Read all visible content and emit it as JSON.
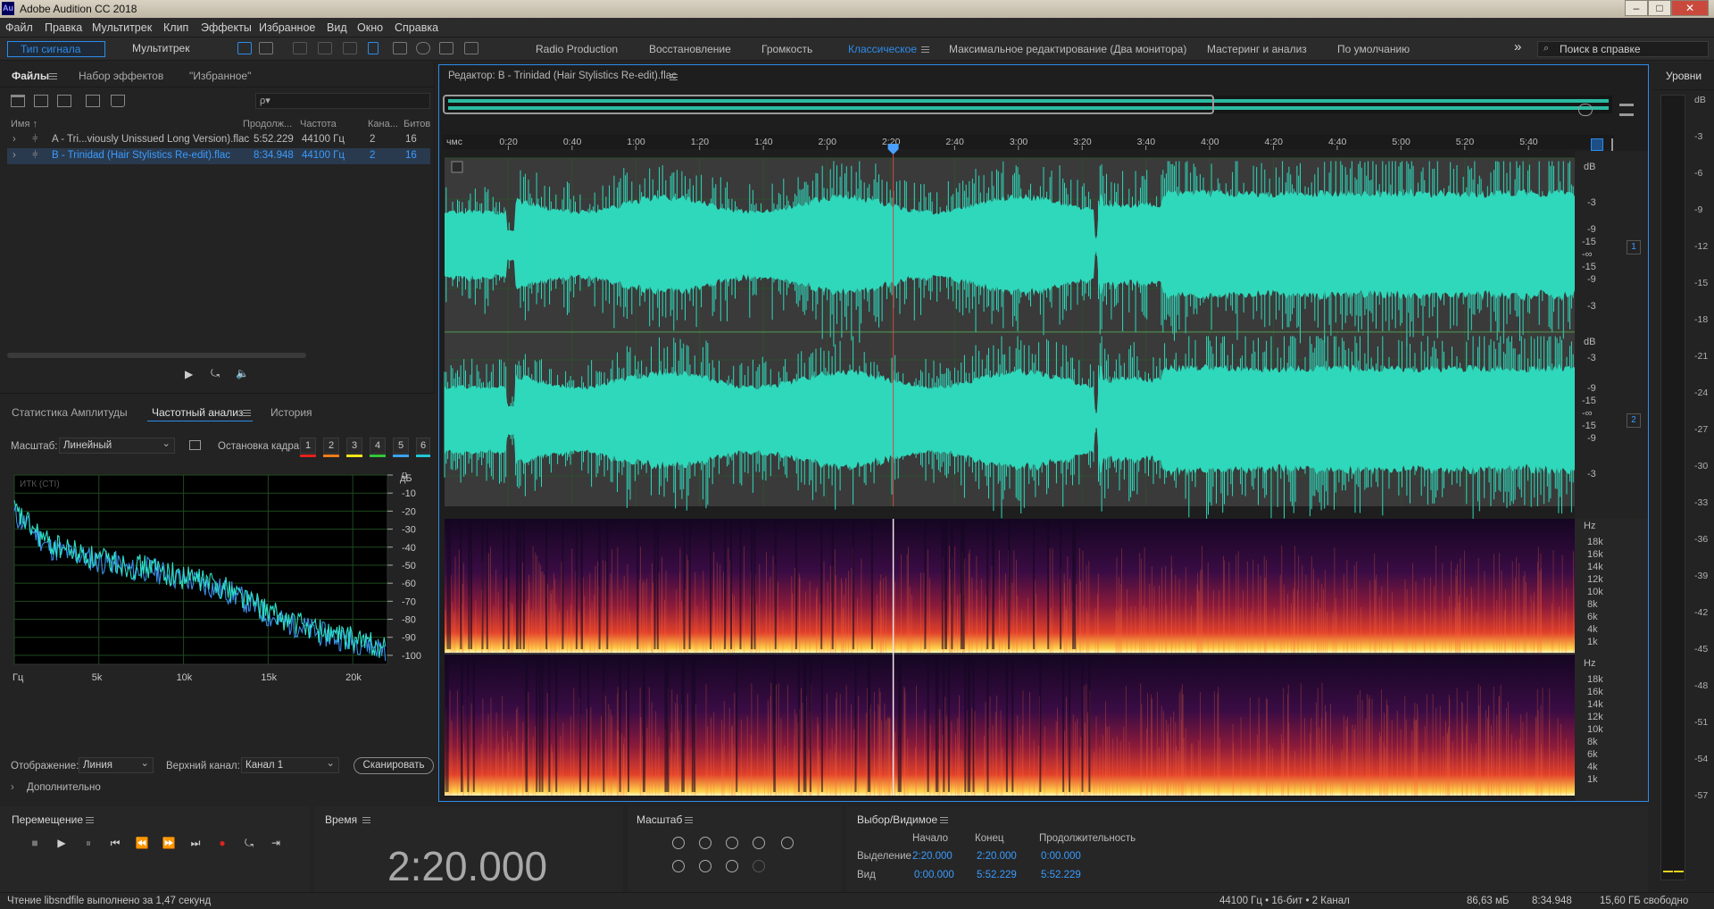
{
  "window": {
    "title": "Adobe Audition CC 2018",
    "logo": "Au",
    "buttons": [
      "–",
      "□",
      "✕"
    ]
  },
  "menu": [
    "Файл",
    "Правка",
    "Мультитрек",
    "Клип",
    "Эффекты",
    "Избранное",
    "Вид",
    "Окно",
    "Справка"
  ],
  "toolbar": {
    "mode_waveform": "Тип сигнала",
    "mode_multitrack": "Мультитрек",
    "workspaces": [
      {
        "label": "Radio Production",
        "active": false
      },
      {
        "label": "Восстановление",
        "active": false
      },
      {
        "label": "Громкость",
        "active": false
      },
      {
        "label": "Классическое",
        "active": true
      },
      {
        "label": "Максимальное редактирование (Два монитора)",
        "active": false
      },
      {
        "label": "Мастеринг и анализ",
        "active": false
      },
      {
        "label": "По умолчанию",
        "active": false
      }
    ],
    "more": "»",
    "search_placeholder": "Поиск в справке"
  },
  "files_panel": {
    "tabs": [
      {
        "label": "Файлы",
        "active": true
      },
      {
        "label": "Набор эффектов",
        "active": false
      },
      {
        "label": "\"Избранное\"",
        "active": false
      }
    ],
    "search_placeholder": "ρ▾",
    "columns": [
      "Имя ↑",
      "Продолж...",
      "Частота",
      "Кана...",
      "Битов"
    ],
    "rows": [
      {
        "name": "A - Tri...viously Unissued Long Version).flac",
        "duration": "5:52.229",
        "rate": "44100 Гц",
        "channels": "2",
        "bits": "16",
        "selected": false
      },
      {
        "name": "B - Trinidad (Hair Stylistics Re-edit).flac",
        "duration": "8:34.948",
        "rate": "44100 Гц",
        "channels": "2",
        "bits": "16",
        "selected": true
      }
    ]
  },
  "analysis_panel": {
    "tabs": [
      {
        "label": "Статистика Амплитуды",
        "active": false
      },
      {
        "label": "Частотный анализ",
        "active": true
      },
      {
        "label": "История",
        "active": false
      }
    ],
    "scale_label": "Масштаб:",
    "scale_value": "Линейный",
    "freeze_label": "Остановка кадра:",
    "freeze_slots": [
      "1",
      "2",
      "3",
      "4",
      "5",
      "6"
    ],
    "freeze_colors": [
      "#e0241c",
      "#f07d1a",
      "#f3e61b",
      "#32c837",
      "#3aa3f0",
      "#20c8d8"
    ],
    "graph_label": "ИТК (CTI)",
    "display_label": "Отображение:",
    "display_value": "Линия",
    "channel_label": "Верхний канал:",
    "channel_value": "Канал 1",
    "scan_button": "Сканировать",
    "advanced": "Дополнительно"
  },
  "chart_data": {
    "type": "line",
    "title": "",
    "xlabel": "Гц",
    "ylabel": "дБ",
    "x_ticks": [
      "Гц",
      "5k",
      "10k",
      "15k",
      "20k"
    ],
    "y_ticks": [
      "0",
      "-10",
      "-20",
      "-30",
      "-40",
      "-50",
      "-60",
      "-70",
      "-80",
      "-90",
      "-100"
    ],
    "xlim": [
      0,
      22050
    ],
    "ylim": [
      -105,
      0
    ],
    "series": [
      {
        "color": "#3a8fe8",
        "x": [
          0,
          1000,
          2000,
          3000,
          4000,
          5000,
          6000,
          7000,
          8000,
          9000,
          10000,
          11000,
          12000,
          13000,
          14000,
          15000,
          16000,
          17000,
          18000,
          19000,
          20000,
          21000,
          22000
        ],
        "y": [
          -22,
          -30,
          -40,
          -43,
          -45,
          -48,
          -49,
          -53,
          -52,
          -55,
          -58,
          -60,
          -63,
          -66,
          -72,
          -78,
          -82,
          -84,
          -88,
          -90,
          -92,
          -94,
          -97
        ]
      },
      {
        "color": "#2ee0c8",
        "x": [
          0,
          1000,
          2000,
          3000,
          4000,
          5000,
          6000,
          7000,
          8000,
          9000,
          10000,
          11000,
          12000,
          13000,
          14000,
          15000,
          16000,
          17000,
          18000,
          19000,
          20000,
          21000,
          22000
        ],
        "y": [
          -20,
          -29,
          -38,
          -41,
          -44,
          -47,
          -48,
          -51,
          -51,
          -54,
          -57,
          -58,
          -61,
          -64,
          -70,
          -76,
          -80,
          -83,
          -86,
          -89,
          -91,
          -93,
          -96
        ]
      }
    ]
  },
  "editor": {
    "title": "Редактор: B - Trinidad (Hair Stylistics Re-edit).flac",
    "ruler_unit": "чмс",
    "ruler_ticks": [
      "0:20",
      "0:40",
      "1:00",
      "1:20",
      "1:40",
      "2:00",
      "2:20",
      "2:40",
      "3:00",
      "3:20",
      "3:40",
      "4:00",
      "4:20",
      "4:40",
      "5:00",
      "5:20",
      "5:40"
    ],
    "playhead_fraction": 0.397,
    "db_label": "dB",
    "db_ticks_ch1": [
      "-3",
      "-9",
      "-15",
      "-∞",
      "-15",
      "-9",
      "-3"
    ],
    "db_ticks_ch2": [
      "-3",
      "-9",
      "-15",
      "-∞",
      "-15",
      "-9",
      "-3"
    ],
    "channel_1": "1",
    "channel_2": "2",
    "hz_label": "Hz",
    "hz_ticks": [
      "18k",
      "16k",
      "14k",
      "12k",
      "10k",
      "8k",
      "6k",
      "4k",
      "1k"
    ],
    "waveform_color": "#2fd8bb"
  },
  "transport": {
    "title": "Перемещение",
    "buttons": [
      "■",
      "▶",
      "⏸",
      "⏮",
      "⏪",
      "⏩",
      "⏭",
      "●",
      "⤿",
      "⇥"
    ]
  },
  "time": {
    "title": "Время",
    "value": "2:20.000"
  },
  "zoom": {
    "title": "Масштаб"
  },
  "selection": {
    "title": "Выбор/Видимое",
    "cols": [
      "Начало",
      "Конец",
      "Продолжительность"
    ],
    "rows": [
      {
        "label": "Выделение",
        "start": "2:20.000",
        "end": "2:20.000",
        "dur": "0:00.000"
      },
      {
        "label": "Вид",
        "start": "0:00.000",
        "end": "5:52.229",
        "dur": "5:52.229"
      }
    ]
  },
  "levels": {
    "title": "Уровни",
    "ticks": [
      "dB",
      "-3",
      "-6",
      "-9",
      "-12",
      "-15",
      "-18",
      "-21",
      "-24",
      "-27",
      "-30",
      "-33",
      "-36",
      "-39",
      "-42",
      "-45",
      "-48",
      "-51",
      "-54",
      "-57"
    ]
  },
  "status": {
    "message": "Чтение libsndfile выполнено за 1,47 секунд",
    "format": "44100 Гц • 16-бит • 2 Канал",
    "size": "86,63 мБ",
    "duration": "8:34.948",
    "free": "15,60 ГБ свободно"
  }
}
